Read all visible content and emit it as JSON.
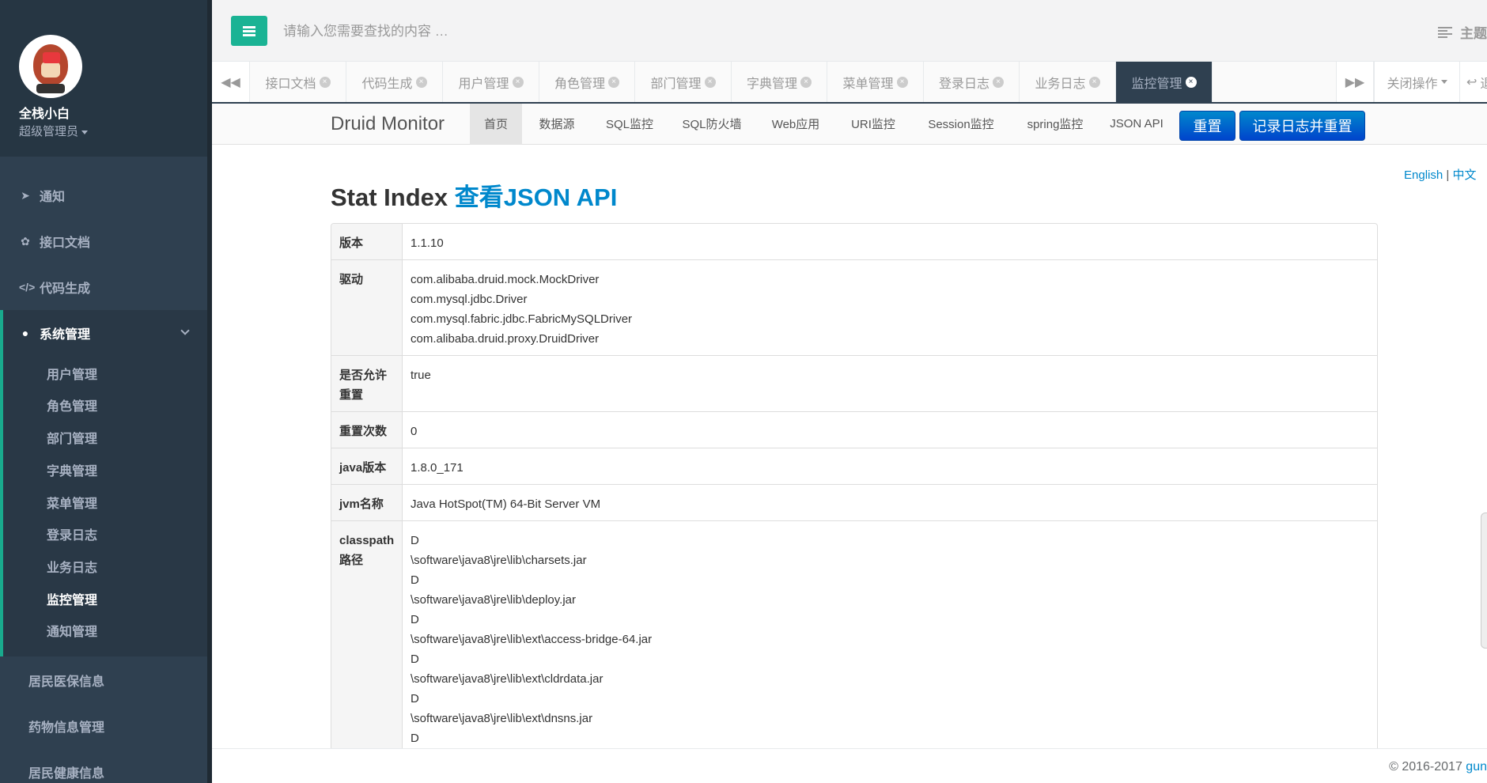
{
  "sidebar": {
    "user_name": "全栈小白",
    "user_role": "超级管理员",
    "menu": [
      {
        "label": "通知",
        "icon": "rocket-icon"
      },
      {
        "label": "接口文档",
        "icon": "leaf-icon"
      },
      {
        "label": "代码生成",
        "icon": "code-icon"
      },
      {
        "label": "系统管理",
        "icon": "user-icon"
      }
    ],
    "system_submenu": [
      "用户管理",
      "角色管理",
      "部门管理",
      "字典管理",
      "菜单管理",
      "登录日志",
      "业务日志",
      "监控管理",
      "通知管理"
    ],
    "current_submenu": "监控管理",
    "other_menu": [
      "居民医保信息",
      "药物信息管理",
      "居民健康信息"
    ]
  },
  "topbar": {
    "search_placeholder": "请输入您需要查找的内容 …",
    "theme_label": "主题"
  },
  "tabs": {
    "items": [
      "接口文档",
      "代码生成",
      "用户管理",
      "角色管理",
      "部门管理",
      "字典管理",
      "菜单管理",
      "登录日志",
      "业务日志",
      "监控管理"
    ],
    "active": "监控管理",
    "close_ops_label": "关闭操作",
    "exit_label": "退"
  },
  "druid": {
    "brand": "Druid Monitor",
    "nav": [
      "首页",
      "数据源",
      "SQL监控",
      "SQL防火墙",
      "Web应用",
      "URI监控",
      "Session监控",
      "spring监控",
      "JSON API"
    ],
    "active_nav": "首页",
    "reset_label": "重置",
    "log_reset_label": "记录日志并重置"
  },
  "content": {
    "lang_en": "English",
    "lang_sep": "|",
    "lang_zh": "中文",
    "title": "Stat Index",
    "title_link": "查看JSON API",
    "rows": [
      {
        "key": "版本",
        "values": [
          "1.1.10"
        ]
      },
      {
        "key": "驱动",
        "values": [
          "com.alibaba.druid.mock.MockDriver",
          "com.mysql.jdbc.Driver",
          "com.mysql.fabric.jdbc.FabricMySQLDriver",
          "com.alibaba.druid.proxy.DruidDriver"
        ]
      },
      {
        "key": "是否允许重置",
        "key_lines": [
          "是否允许",
          "重置"
        ],
        "values": [
          "true"
        ]
      },
      {
        "key": "重置次数",
        "values": [
          "0"
        ]
      },
      {
        "key": "java版本",
        "values": [
          "1.8.0_171"
        ]
      },
      {
        "key": "jvm名称",
        "values": [
          "Java HotSpot(TM) 64-Bit Server VM"
        ]
      },
      {
        "key": "classpath路径",
        "key_lines": [
          "classpath",
          "路径"
        ],
        "values": [
          "D",
          "\\software\\java8\\jre\\lib\\charsets.jar",
          "D",
          "\\software\\java8\\jre\\lib\\deploy.jar",
          "D",
          "\\software\\java8\\jre\\lib\\ext\\access-bridge-64.jar",
          "D",
          "\\software\\java8\\jre\\lib\\ext\\cldrdata.jar",
          "D",
          "\\software\\java8\\jre\\lib\\ext\\dnsns.jar",
          "D"
        ]
      }
    ]
  },
  "footer": {
    "copyright": "© 2016-2017",
    "link": "gun"
  }
}
